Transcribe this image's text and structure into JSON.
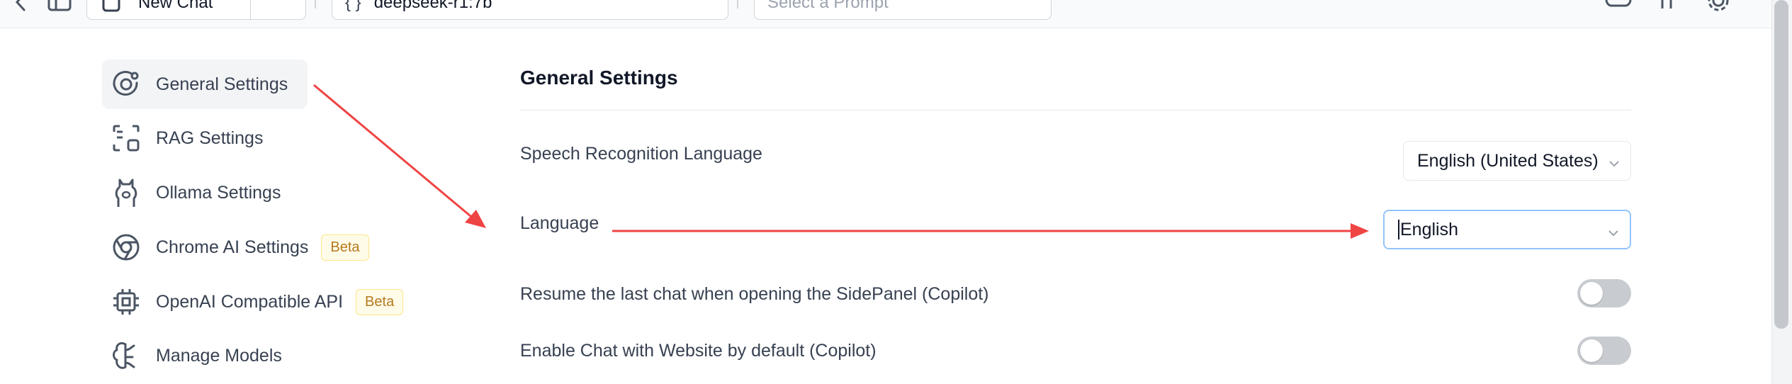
{
  "topbar": {
    "new_chat_label": "New Chat",
    "model_label": "deepseek-r1:7b",
    "prompt_placeholder": "Select a Prompt",
    "icons": [
      "back-icon",
      "sidebar-toggle-icon",
      "chat-icon",
      "model-icon",
      "brain-icon",
      "github-icon",
      "settings-icon"
    ]
  },
  "sidebar": {
    "items": [
      {
        "label": "General Settings",
        "icon": "orbit-icon",
        "active": true
      },
      {
        "label": "RAG Settings",
        "icon": "scan-icon",
        "active": false
      },
      {
        "label": "Ollama Settings",
        "icon": "llama-icon",
        "active": false
      },
      {
        "label": "Chrome AI Settings",
        "icon": "chrome-icon",
        "badge": "Beta",
        "active": false
      },
      {
        "label": "OpenAI Compatible API",
        "icon": "cpu-icon",
        "badge": "Beta",
        "active": false
      },
      {
        "label": "Manage Models",
        "icon": "brain-icon",
        "active": false
      }
    ]
  },
  "main": {
    "title": "General Settings",
    "rows": [
      {
        "label": "Speech Recognition Language",
        "value": "English (United States)"
      },
      {
        "label": "Language",
        "value": "English"
      },
      {
        "label": "Resume the last chat when opening the SidePanel (Copilot)",
        "toggle": false
      },
      {
        "label": "Enable Chat with Website by default (Copilot)",
        "toggle": false
      }
    ]
  },
  "colors": {
    "accent_arrow": "#ef4444",
    "badge_text": "#b7791f",
    "badge_bg": "#fefce8",
    "focus_ring": "#93c5fd",
    "toggle_off": "#c8cbd0"
  }
}
